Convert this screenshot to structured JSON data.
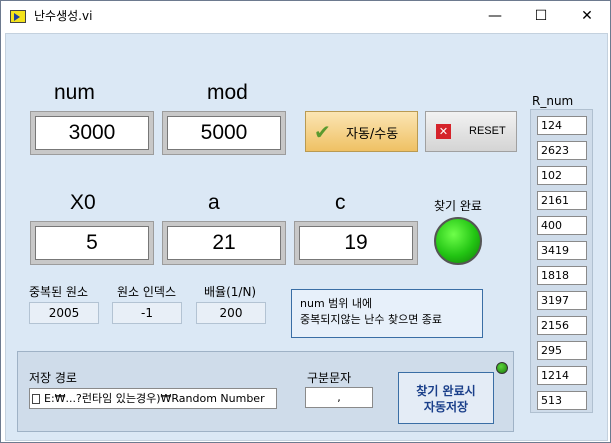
{
  "window": {
    "title": "난수생성.vi",
    "minimize": "—",
    "maximize": "☐",
    "close": "✕"
  },
  "inputs": {
    "num": {
      "label": "num",
      "value": "3000"
    },
    "mod": {
      "label": "mod",
      "value": "5000"
    },
    "x0": {
      "label": "X0",
      "value": "5"
    },
    "a": {
      "label": "a",
      "value": "21"
    },
    "c": {
      "label": "c",
      "value": "19"
    }
  },
  "buttons": {
    "auto_manual": "자동/수동",
    "reset": "RESET",
    "auto_save": [
      "찾기 완료시",
      "자동저장"
    ]
  },
  "indicators": {
    "found_done_label": "찾기 완료",
    "dup_element": {
      "label": "중복된 원소",
      "value": "2005"
    },
    "element_index": {
      "label": "원소 인덱스",
      "value": "-1"
    },
    "ratio": {
      "label": "배율(1/N)",
      "value": "200"
    },
    "message": [
      "num 범위 내에",
      "중복되지않는 난수 찾으면 종료"
    ]
  },
  "save": {
    "path_label": "저장 경로",
    "path_value": "E:₩...?런타임 있는경우)₩Random Number",
    "separator_label": "구분문자",
    "separator_value": ","
  },
  "r_num": {
    "label": "R_num",
    "values": [
      "124",
      "2623",
      "102",
      "2161",
      "400",
      "3419",
      "1818",
      "3197",
      "2156",
      "295",
      "1214",
      "513"
    ]
  },
  "colors": {
    "led_on": "#22c413",
    "panel_bg": "#dbe8f5"
  }
}
